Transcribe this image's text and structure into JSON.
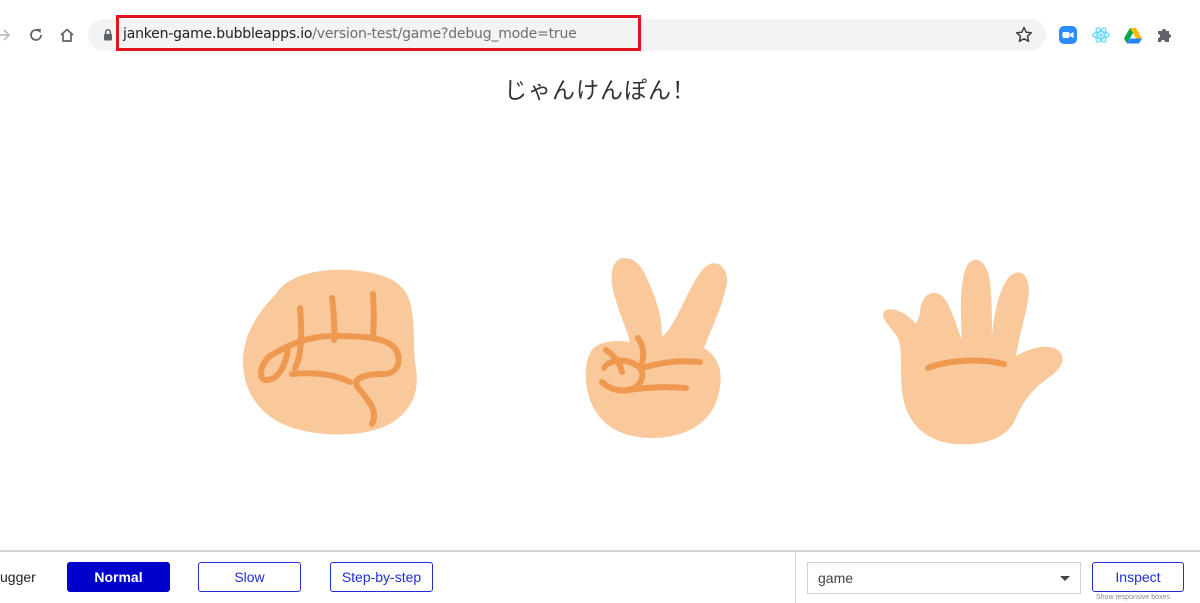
{
  "browser": {
    "url_host": "janken-game.bubbleapps.io",
    "url_path": "/version-test/game?debug_mode=true",
    "icons": {
      "forward": "arrow-right-icon",
      "reload": "reload-icon",
      "home": "home-icon",
      "secure": "lock-icon",
      "bookmark": "star-icon"
    },
    "extensions": [
      "zoom-extension-icon",
      "react-extension-icon",
      "google-drive-icon",
      "puzzle-extensions-icon"
    ]
  },
  "page": {
    "title": "じゃんけんぽん！",
    "hands": [
      {
        "icon": "rock-hand-icon"
      },
      {
        "icon": "scissors-hand-icon"
      },
      {
        "icon": "paper-hand-icon"
      }
    ],
    "colors": {
      "skin": "#f9c89b",
      "line": "#ef9850"
    }
  },
  "debugger": {
    "label": "Debugger",
    "visible_label": "ugger",
    "modes": [
      "Normal",
      "Slow",
      "Step-by-step"
    ],
    "active_mode": "Normal",
    "page_select": {
      "value": "game"
    },
    "inspect_label": "Inspect",
    "responsive_label": "Show responsive boxes",
    "colors": {
      "primary": "#0000cc"
    }
  }
}
